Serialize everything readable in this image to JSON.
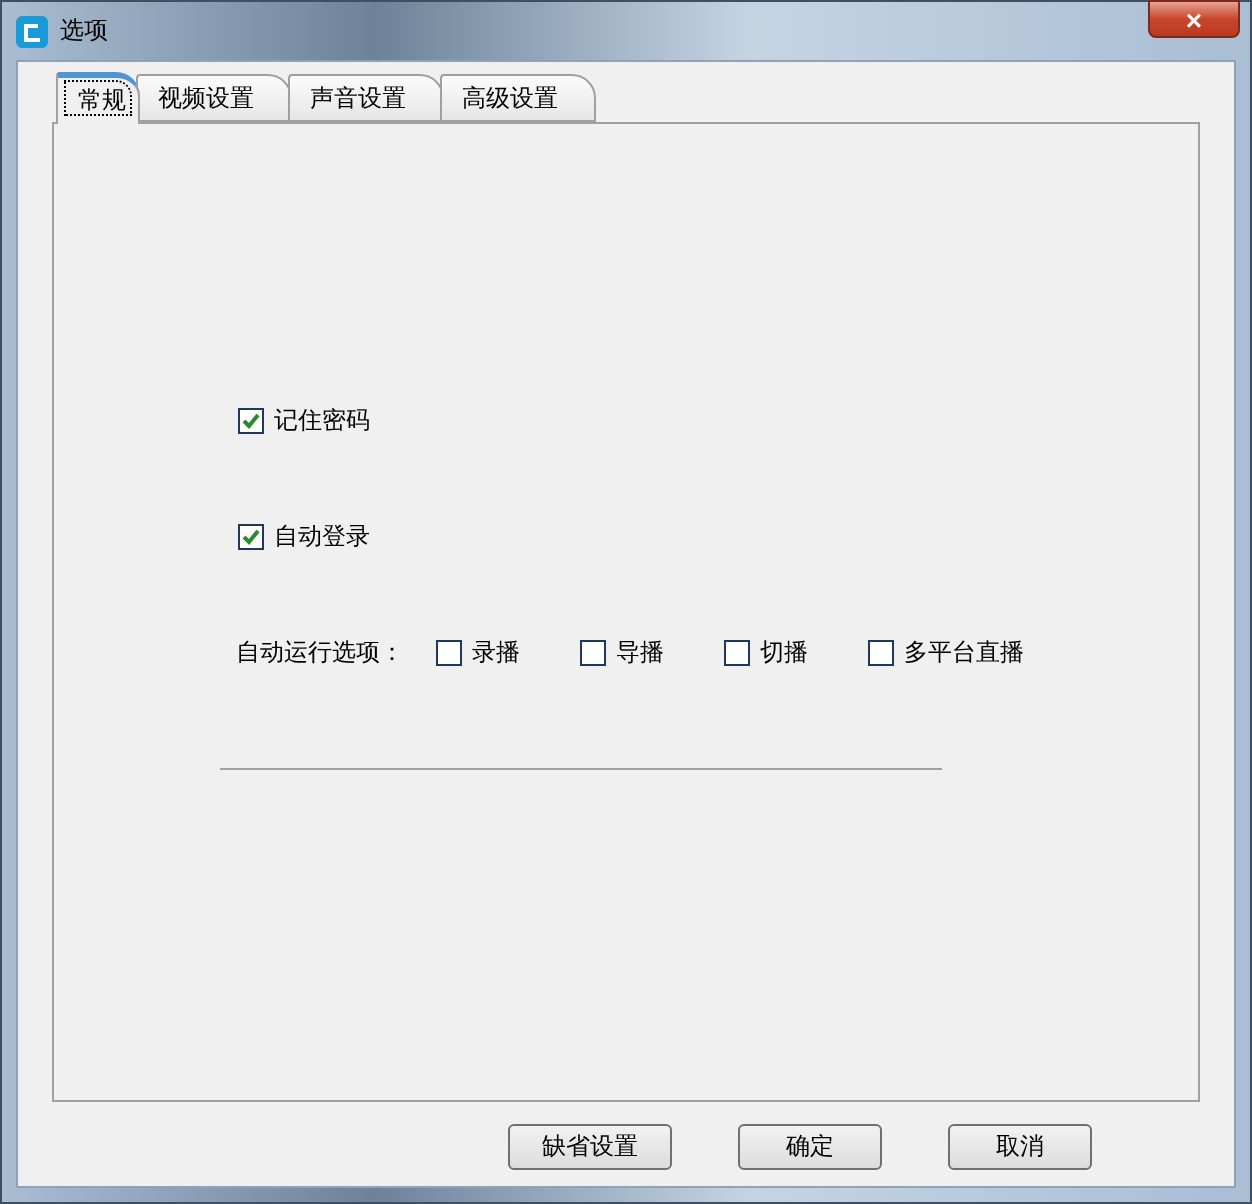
{
  "window": {
    "title": "选项",
    "close": "×"
  },
  "tabs": [
    {
      "label": "常规",
      "selected": true
    },
    {
      "label": "视频设置",
      "selected": false
    },
    {
      "label": "声音设置",
      "selected": false
    },
    {
      "label": "高级设置",
      "selected": false
    }
  ],
  "options": [
    {
      "label": "记住密码",
      "checked": true
    },
    {
      "label": "自动登录",
      "checked": true
    }
  ],
  "autorun": {
    "label": "自动运行选项：",
    "items": [
      {
        "label": "录播",
        "checked": false
      },
      {
        "label": "导播",
        "checked": false
      },
      {
        "label": "切播",
        "checked": false
      },
      {
        "label": "多平台直播",
        "checked": false
      }
    ]
  },
  "buttons": [
    "缺省设置",
    "确定",
    "取消"
  ]
}
